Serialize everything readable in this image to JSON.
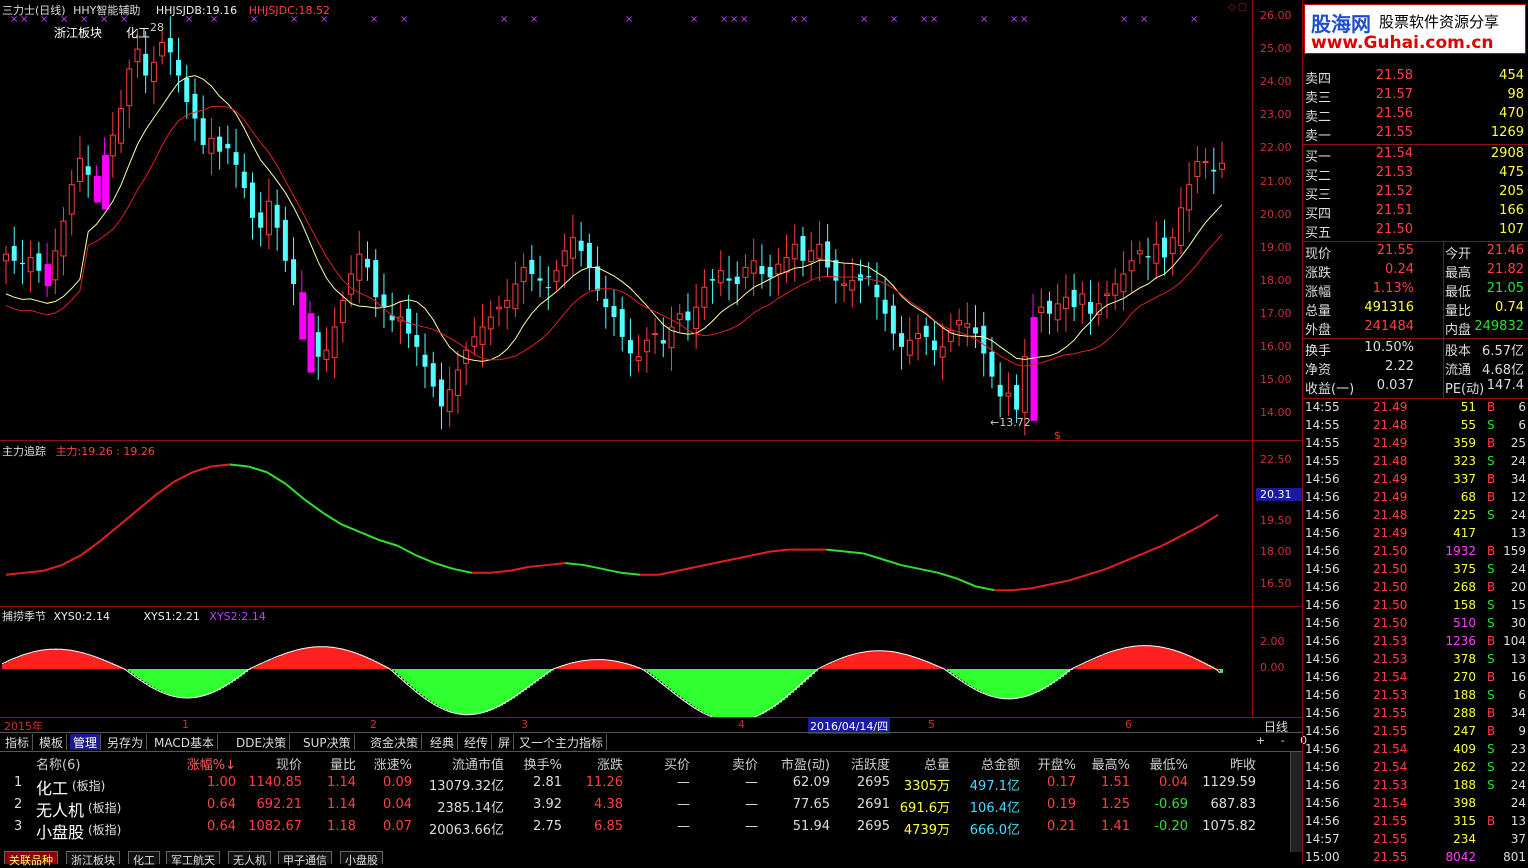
{
  "header": {
    "stock": "三力士(日线)",
    "indicator": "HHY智能辅助",
    "v1_label": "HHJSJDB:",
    "v1": "19.16",
    "v2_label": "HHJSJDC:",
    "v2": "18.52",
    "labels": [
      "浙江板块",
      "化工"
    ],
    "peak_label": "28",
    "low_label": "13.72"
  },
  "price_axis": [
    "26.00",
    "25.00",
    "24.00",
    "23.00",
    "22.00",
    "21.00",
    "20.00",
    "19.00",
    "18.00",
    "17.00",
    "16.00",
    "15.00",
    "14.00"
  ],
  "panel2": {
    "title": "主力追踪",
    "sub_label": "主力:",
    "sub": "19.26 : 19.26",
    "axis": [
      "22.50",
      "20.31",
      "19.50",
      "18.00",
      "16.50"
    ],
    "current": "20.31"
  },
  "panel3": {
    "title": "捕捞季节",
    "xys0_label": "XYS0:",
    "xys0": "2.14",
    "xys1_label": "XYS1:",
    "xys1": "2.21",
    "xys2_label": "XYS2:",
    "xys2": "2.14",
    "axis": [
      "2.00",
      "0.00"
    ]
  },
  "date_axis": {
    "year": "2015年",
    "months": [
      "1",
      "2",
      "3",
      "4",
      "5",
      "6"
    ],
    "cursor": "2016/04/14/四",
    "period": "日线"
  },
  "watermark": {
    "brand": "股海网",
    "text": "股票软件资源分享",
    "url": "www.Guhai.com.cn"
  },
  "quote": {
    "asks": [
      {
        "label": "卖四",
        "price": "21.58",
        "vol": "454"
      },
      {
        "label": "卖三",
        "price": "21.57",
        "vol": "98"
      },
      {
        "label": "卖二",
        "price": "21.56",
        "vol": "470"
      },
      {
        "label": "卖一",
        "price": "21.55",
        "vol": "1269"
      }
    ],
    "bids": [
      {
        "label": "买一",
        "price": "21.54",
        "vol": "2908"
      },
      {
        "label": "买二",
        "price": "21.53",
        "vol": "475"
      },
      {
        "label": "买三",
        "price": "21.52",
        "vol": "205"
      },
      {
        "label": "买四",
        "price": "21.51",
        "vol": "166"
      },
      {
        "label": "买五",
        "price": "21.50",
        "vol": "107"
      }
    ],
    "stats": [
      {
        "l1": "现价",
        "v1": "21.55",
        "l2": "今开",
        "v2": "21.46"
      },
      {
        "l1": "涨跌",
        "v1": "0.24",
        "l2": "最高",
        "v2": "21.82"
      },
      {
        "l1": "涨幅",
        "v1": "1.13%",
        "l2": "最低",
        "v2": "21.05"
      },
      {
        "l1": "总量",
        "v1": "491316",
        "l2": "量比",
        "v2": "0.74"
      },
      {
        "l1": "外盘",
        "v1": "241484",
        "l2": "内盘",
        "v2": "249832"
      },
      {
        "l1": "换手",
        "v1": "10.50%",
        "l2": "股本",
        "v2": "6.57亿"
      },
      {
        "l1": "净资",
        "v1": "2.22",
        "l2": "流通",
        "v2": "4.68亿"
      },
      {
        "l1": "收益(一)",
        "v1": "0.037",
        "l2": "PE(动)",
        "v2": "147.4"
      }
    ]
  },
  "ticks": [
    {
      "t": "14:55",
      "p": "21.49",
      "v": "51",
      "d": "B",
      "n": "6"
    },
    {
      "t": "14:55",
      "p": "21.48",
      "v": "55",
      "d": "S",
      "n": "6"
    },
    {
      "t": "14:55",
      "p": "21.49",
      "v": "359",
      "d": "B",
      "n": "25"
    },
    {
      "t": "14:55",
      "p": "21.48",
      "v": "323",
      "d": "S",
      "n": "24"
    },
    {
      "t": "14:56",
      "p": "21.49",
      "v": "337",
      "d": "B",
      "n": "34"
    },
    {
      "t": "14:56",
      "p": "21.49",
      "v": "68",
      "d": "B",
      "n": "12"
    },
    {
      "t": "14:56",
      "p": "21.48",
      "v": "225",
      "d": "S",
      "n": "24"
    },
    {
      "t": "14:56",
      "p": "21.49",
      "v": "417",
      "d": "",
      "n": "13"
    },
    {
      "t": "14:56",
      "p": "21.50",
      "v": "1932",
      "d": "B",
      "n": "159"
    },
    {
      "t": "14:56",
      "p": "21.50",
      "v": "375",
      "d": "S",
      "n": "24"
    },
    {
      "t": "14:56",
      "p": "21.50",
      "v": "268",
      "d": "B",
      "n": "20"
    },
    {
      "t": "14:56",
      "p": "21.50",
      "v": "158",
      "d": "S",
      "n": "15"
    },
    {
      "t": "14:56",
      "p": "21.50",
      "v": "510",
      "d": "S",
      "n": "30"
    },
    {
      "t": "14:56",
      "p": "21.53",
      "v": "1236",
      "d": "B",
      "n": "104"
    },
    {
      "t": "14:56",
      "p": "21.53",
      "v": "378",
      "d": "S",
      "n": "13"
    },
    {
      "t": "14:56",
      "p": "21.54",
      "v": "270",
      "d": "B",
      "n": "16"
    },
    {
      "t": "14:56",
      "p": "21.53",
      "v": "188",
      "d": "S",
      "n": "6"
    },
    {
      "t": "14:56",
      "p": "21.55",
      "v": "288",
      "d": "B",
      "n": "34"
    },
    {
      "t": "14:56",
      "p": "21.55",
      "v": "247",
      "d": "B",
      "n": "9"
    },
    {
      "t": "14:56",
      "p": "21.54",
      "v": "409",
      "d": "S",
      "n": "23"
    },
    {
      "t": "14:56",
      "p": "21.54",
      "v": "262",
      "d": "S",
      "n": "22"
    },
    {
      "t": "14:56",
      "p": "21.53",
      "v": "188",
      "d": "S",
      "n": "24"
    },
    {
      "t": "14:56",
      "p": "21.54",
      "v": "398",
      "d": "",
      "n": "24"
    },
    {
      "t": "14:56",
      "p": "21.55",
      "v": "315",
      "d": "B",
      "n": "13"
    },
    {
      "t": "14:57",
      "p": "21.55",
      "v": "234",
      "d": "",
      "n": "37"
    },
    {
      "t": "15:00",
      "p": "21.55",
      "v": "8042",
      "d": "",
      "n": "801"
    }
  ],
  "toolbar": [
    "指标",
    "模板",
    "管理",
    "另存为",
    "MACD基本",
    "DDE决策",
    "SUP决策",
    "资金决策",
    "经典",
    "经传",
    "屏",
    "又一个主力指标"
  ],
  "table": {
    "headers": [
      "名称(6)",
      "涨幅%↓",
      "现价",
      "量比",
      "涨速%",
      "流通市值",
      "换手%",
      "涨跌",
      "买价",
      "卖价",
      "市盈(动)",
      "活跃度",
      "总量",
      "总金额",
      "开盘%",
      "最高%",
      "最低%",
      "昨收"
    ],
    "rows": [
      {
        "idx": "1",
        "name": "化工",
        "tag": "(板指)",
        "chg": "1.00",
        "price": "1140.85",
        "vr": "1.14",
        "speed": "0.09",
        "cap": "13079.32亿",
        "turn": "2.81",
        "diff": "11.26",
        "bid": "—",
        "ask": "—",
        "pe": "62.09",
        "act": "2695",
        "vol": "3305万",
        "amt": "497.1亿",
        "open": "0.17",
        "high": "1.51",
        "low": "0.04",
        "prev": "1129.59"
      },
      {
        "idx": "2",
        "name": "无人机",
        "tag": "(板指)",
        "chg": "0.64",
        "price": "692.21",
        "vr": "1.14",
        "speed": "0.04",
        "cap": "2385.14亿",
        "turn": "3.92",
        "diff": "4.38",
        "bid": "—",
        "ask": "—",
        "pe": "77.65",
        "act": "2691",
        "vol": "691.6万",
        "amt": "106.4亿",
        "open": "0.19",
        "high": "1.25",
        "low": "-0.69",
        "prev": "687.83"
      },
      {
        "idx": "3",
        "name": "小盘股",
        "tag": "(板指)",
        "chg": "0.64",
        "price": "1082.67",
        "vr": "1.18",
        "speed": "0.07",
        "cap": "20063.66亿",
        "turn": "2.75",
        "diff": "6.85",
        "bid": "—",
        "ask": "—",
        "pe": "51.94",
        "act": "2695",
        "vol": "4739万",
        "amt": "666.0亿",
        "open": "0.21",
        "high": "1.41",
        "low": "-0.20",
        "prev": "1075.82"
      }
    ]
  },
  "bottom_tabs": [
    "关联品种",
    "浙江板块",
    "化工",
    "军工航天",
    "无人机",
    "甲子通信",
    "小盘股"
  ],
  "colors": {
    "up": "#ff3c3c",
    "down": "#54ffff",
    "ma_fast": "#ffffa0",
    "ma_slow": "#e02020",
    "grid": "#8b1010"
  }
}
